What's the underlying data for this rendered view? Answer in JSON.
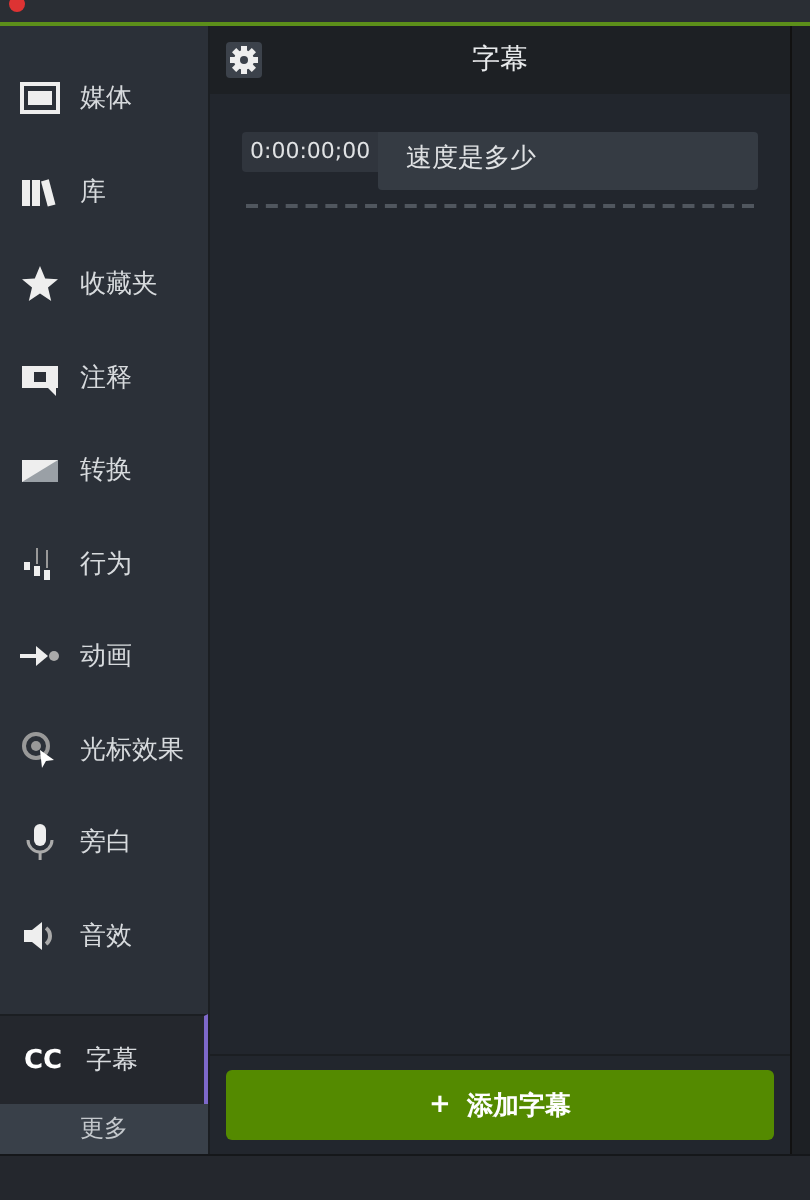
{
  "sidebar": {
    "items": [
      {
        "label": "媒体",
        "selected": false
      },
      {
        "label": "库",
        "selected": false
      },
      {
        "label": "收藏夹",
        "selected": false
      },
      {
        "label": "注释",
        "selected": false
      },
      {
        "label": "转换",
        "selected": false
      },
      {
        "label": "行为",
        "selected": false
      },
      {
        "label": "动画",
        "selected": false
      },
      {
        "label": "光标效果",
        "selected": false
      },
      {
        "label": "旁白",
        "selected": false
      },
      {
        "label": "音效",
        "selected": false
      }
    ],
    "active": {
      "icon_text": "CC",
      "label": "字幕",
      "selected": true
    },
    "more": "更多"
  },
  "panel": {
    "title": "字幕",
    "captions": [
      {
        "time": "0:00:00;00",
        "text": "速度是多少"
      }
    ],
    "add_button": {
      "icon": "+",
      "label": "添加字幕"
    }
  }
}
